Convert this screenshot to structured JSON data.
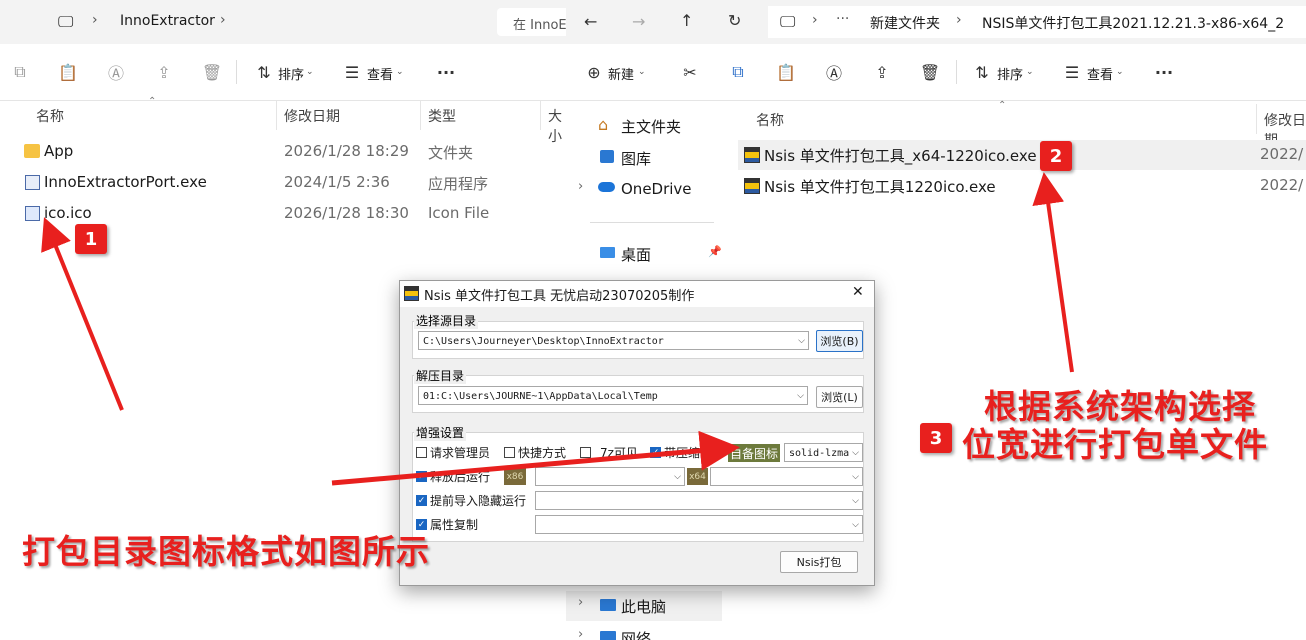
{
  "left_window": {
    "breadcrumb": [
      "InnoExtractor"
    ],
    "search_hint": "在 InnoE",
    "toolbar": {
      "sort_label": "排序",
      "view_label": "查看"
    },
    "columns": [
      "名称",
      "修改日期",
      "类型",
      "大小"
    ],
    "files": [
      {
        "name": "App",
        "date": "2026/1/28 18:29",
        "type": "文件夹",
        "icon": "folder-icon"
      },
      {
        "name": "InnoExtractorPort.exe",
        "date": "2024/1/5 2:36",
        "type": "应用程序",
        "icon": "exe-icon"
      },
      {
        "name": "ico.ico",
        "date": "2026/1/28 18:30",
        "type": "Icon File",
        "icon": "ico-file-icon"
      }
    ]
  },
  "right_window": {
    "breadcrumb": [
      "新建文件夹",
      "NSIS单文件打包工具2021.12.21.3-x86-x64_2"
    ],
    "toolbar": {
      "new_label": "新建",
      "sort_label": "排序",
      "view_label": "查看"
    },
    "nav": [
      "主文件夹",
      "图库",
      "OneDrive",
      "桌面",
      "此电脑",
      "网络"
    ],
    "columns": [
      "名称",
      "修改日期"
    ],
    "files": [
      {
        "name": "Nsis 单文件打包工具_x64-1220ico.exe",
        "date": "2022/"
      },
      {
        "name": "Nsis 单文件打包工具1220ico.exe",
        "date": "2022/"
      }
    ]
  },
  "dialog": {
    "title": "Nsis 单文件打包工具 无忧启动23070205制作",
    "source_group": "选择源目录",
    "source_path": "C:\\Users\\Journeyer\\Desktop\\InnoExtractor",
    "browse_b": "浏览(B)",
    "extract_group": "解压目录",
    "extract_path": "01:C:\\Users\\JOURNE~1\\AppData\\Local\\Temp",
    "browse_l": "浏览(L)",
    "enhance_group": "增强设置",
    "opt_admin": "请求管理员",
    "opt_shortcut": "快捷方式",
    "opt_7z": "7z可见",
    "opt_compress": "带压缩",
    "custom_icon_btn": "自备图标",
    "compress_mode": "solid-lzma",
    "opt_run_after": "释放后运行",
    "tag_x86": "x86",
    "tag_x64": "x64",
    "opt_preimport": "提前导入隐藏运行",
    "opt_attr_copy": "属性复制",
    "pack_btn": "Nsis打包"
  },
  "annotations": {
    "marker1": "1",
    "marker2": "2",
    "marker3": "3",
    "text_left": "打包目录图标格式如图所示",
    "text_right_1": "根据系统架构选择",
    "text_right_2": "位宽进行打包单文件",
    "color": "#e8201e"
  }
}
